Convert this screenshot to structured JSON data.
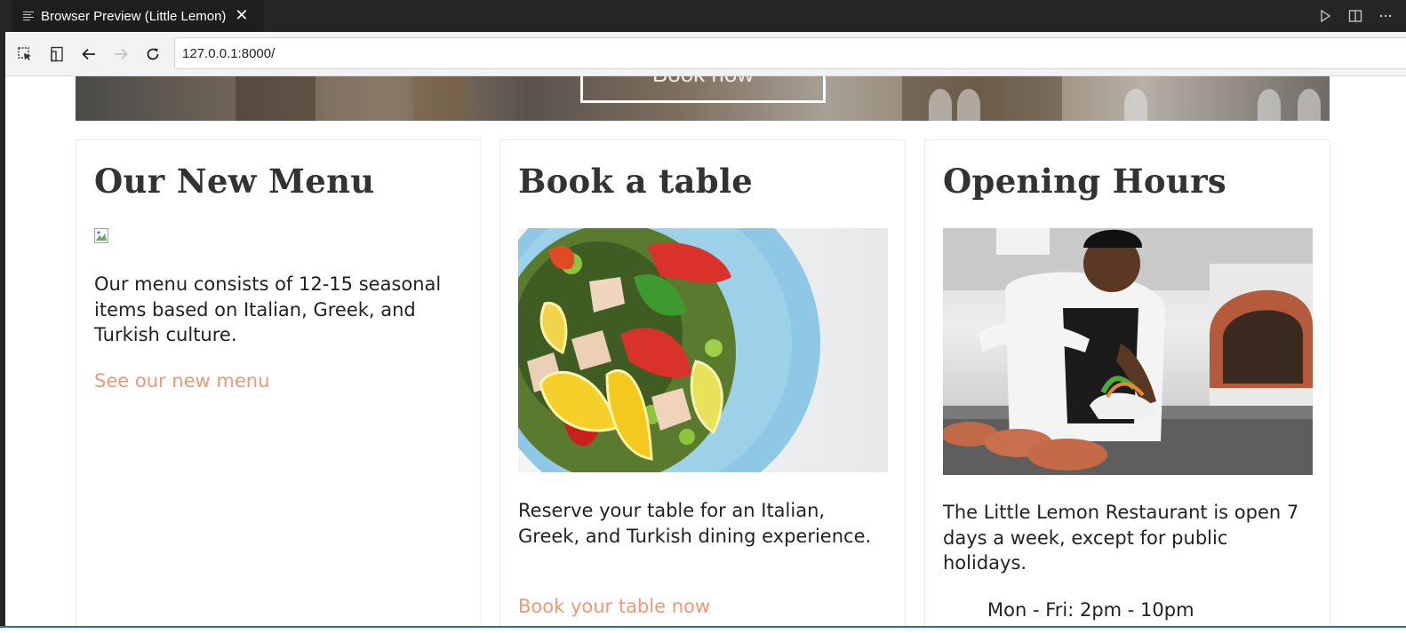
{
  "tab": {
    "title": "Browser Preview (Little Lemon)"
  },
  "toolbar": {
    "url": "127.0.0.1:8000/"
  },
  "hero": {
    "button_label": "Book now"
  },
  "cards": [
    {
      "title": "Our New Menu",
      "text": "Our menu consists of 12-15 seasonal items based on Italian, Greek, and Turkish culture.",
      "link": "See our new menu"
    },
    {
      "title": "Book a table",
      "text": "Reserve your table for an Italian, Greek, and Turkish dining experience.",
      "link": "Book your table now"
    },
    {
      "title": "Opening Hours",
      "text": "The Little Lemon Restaurant is open 7 days a week, except for public holidays.",
      "hours": "Mon - Fri: 2pm - 10pm"
    }
  ],
  "colors": {
    "link": "#ee9972",
    "heading": "#333333",
    "tabbar": "#252526",
    "status_line": "#1f6fb2"
  },
  "icons": [
    "lines-icon",
    "close-icon",
    "run-icon",
    "split-editor-icon",
    "more-icon",
    "inspect-icon",
    "device-icon",
    "back-icon",
    "forward-icon",
    "reload-icon",
    "broken-image-icon"
  ]
}
